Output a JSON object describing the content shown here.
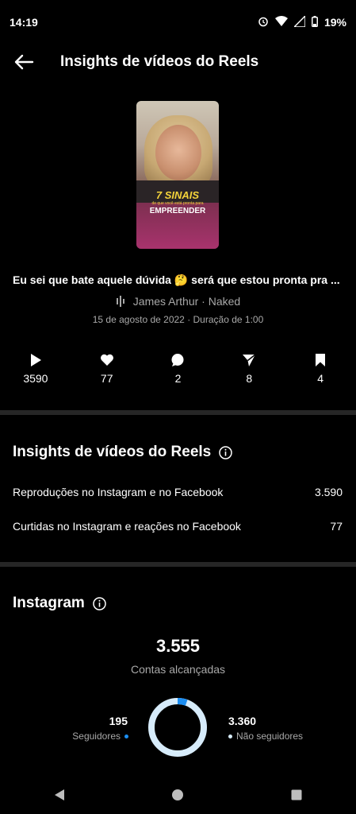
{
  "status_bar": {
    "time": "14:19",
    "battery": "19%"
  },
  "header": {
    "title": "Insights de vídeos do Reels"
  },
  "reel": {
    "thumbnail_text": {
      "line1": "7 SINAIS",
      "line2": "de que você está pronta para",
      "line3": "EMPREENDER"
    },
    "caption": "Eu sei que bate aquele dúvida 🤔 será que estou pronta pra ...",
    "audio": "James Arthur · Naked",
    "meta": "15 de agosto de 2022 · Duração de 1:00"
  },
  "stats": [
    {
      "icon": "play-icon",
      "value": "3590"
    },
    {
      "icon": "heart-icon",
      "value": "77"
    },
    {
      "icon": "comment-icon",
      "value": "2"
    },
    {
      "icon": "share-icon",
      "value": "8"
    },
    {
      "icon": "bookmark-icon",
      "value": "4"
    }
  ],
  "insights_section": {
    "title": "Insights de vídeos do Reels",
    "rows": [
      {
        "label": "Reproduções no Instagram e no Facebook",
        "value": "3.590"
      },
      {
        "label": "Curtidas no Instagram e reações no Facebook",
        "value": "77"
      }
    ]
  },
  "instagram_section": {
    "title": "Instagram",
    "accounts_reached": "3.555",
    "accounts_reached_label": "Contas alcançadas",
    "followers": "195",
    "followers_label": "Seguidores",
    "non_followers": "3.360",
    "non_followers_label": "Não seguidores",
    "followers_fraction": 0.055,
    "colors": {
      "followers": "#1c8ef2",
      "non_followers": "#d7ecfb"
    }
  }
}
